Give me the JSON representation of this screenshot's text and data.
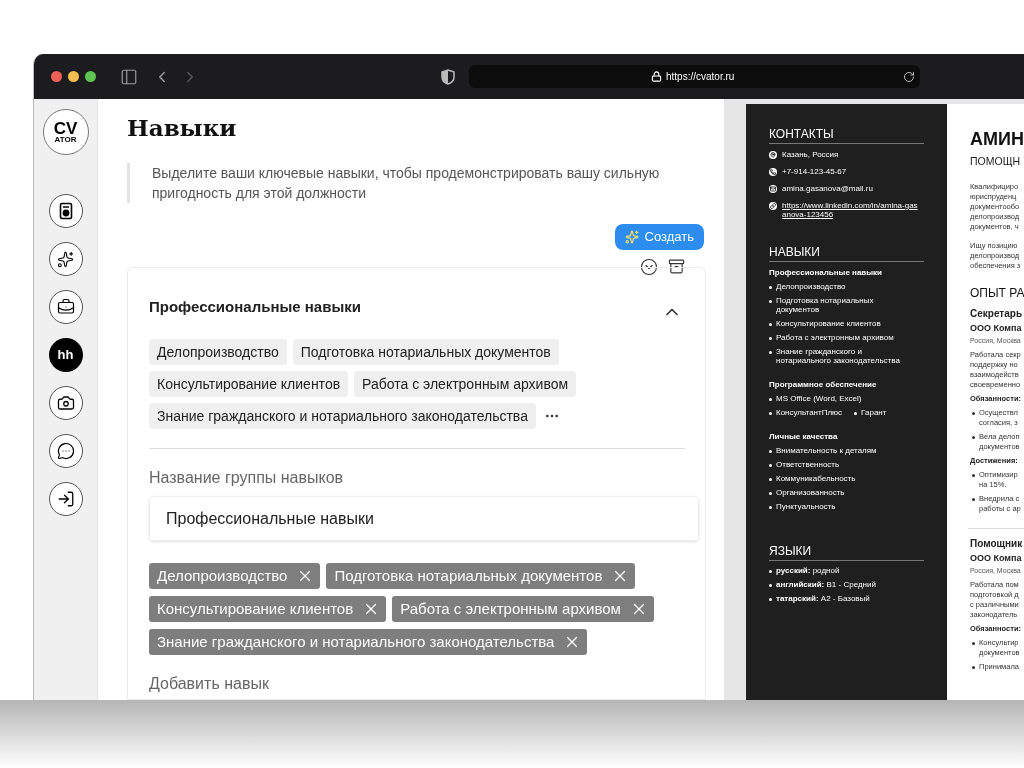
{
  "browser": {
    "url": "https://cvator.ru"
  },
  "sidebar": {
    "logo_top": "CV",
    "logo_bottom": "ATOR",
    "items": [
      {
        "selected": false
      },
      {
        "selected": false
      },
      {
        "selected": false
      },
      {
        "label": "hh",
        "selected": true
      },
      {
        "selected": false
      },
      {
        "selected": false
      },
      {
        "selected": false
      }
    ]
  },
  "editor": {
    "title": "Навыки",
    "hint": "Выделите ваши ключевые навыки, чтобы продемонстрировать вашу сильную пригодность для этой должности",
    "create_button": "Создать",
    "group": {
      "title": "Профессиональные навыки",
      "expanded": true,
      "preview_tags": [
        "Делопроизводство",
        "Подготовка нотариальных документов",
        "Консультирование клиентов",
        "Работа с электронным архивом",
        "Знание гражданского и нотариального законодательства"
      ],
      "name_label": "Название группы навыков",
      "name_value": "Профессиональные навыки",
      "tags": [
        "Делопроизводство",
        "Подготовка нотариальных документов",
        "Консультирование клиентов",
        "Работа с электронным архивом",
        "Знание гражданского и нотариального законодательства"
      ],
      "add_label": "Добавить навык"
    }
  },
  "resume": {
    "sidebar": {
      "contacts_title": "КОНТАКТЫ",
      "contacts": [
        {
          "kind": "location",
          "text": "Казань, Россия"
        },
        {
          "kind": "phone",
          "text": "+7-914-123-45-67"
        },
        {
          "kind": "email",
          "text": "amina.gasanova@mail.ru"
        },
        {
          "kind": "link",
          "text": "https://www.linkedin.com/in/amina-gasanova-123456"
        }
      ],
      "skills_title": "НАВЫКИ",
      "skill_groups": [
        {
          "title": "Профессиональные навыки",
          "items": [
            "Делопроизводство",
            "Подготовка нотариальных документов",
            "Консультирование клиентов",
            "Работа с электронным архивом",
            "Знание гражданского и нотариального законодательства"
          ]
        },
        {
          "title": "Программное обеспечение",
          "items": [
            "MS Office (Word, Excel)",
            "КонсультантПлюс",
            "Гарант"
          ]
        },
        {
          "title": "Личные качества",
          "items": [
            "Внимательность к деталям",
            "Ответственность",
            "Коммуникабельность",
            "Организованность",
            "Пунктуальность"
          ]
        }
      ],
      "languages_title": "ЯЗЫКИ",
      "languages": [
        "**русский:** родной",
        "**английский:** B1 - Средний",
        "**татарский:** A2 - Базовый"
      ]
    },
    "main": {
      "name": "АМИН",
      "role": "ПОМОЩН",
      "summary": [
        [
          "Квалифициро",
          "юриспруденц",
          "документообо",
          "делопроизвод",
          "документов, ч"
        ],
        [
          "Ищу позицию",
          "делопроизвод",
          "обеспечения з"
        ]
      ],
      "section_title": "ОПЫТ РА",
      "jobs": [
        {
          "title": "Секретарь",
          "company": "ООО Компа",
          "location": "Россия, Москва",
          "description": [
            "Работала секр",
            "поддержку но",
            "взаимодейств",
            "своевременно"
          ],
          "blocks": [
            {
              "heading": "Обязанности:",
              "bullets": [
                [
                  "Осуществл",
                  "согласия, з"
                ],
                [
                  "Вела делоп",
                  "документов"
                ]
              ]
            },
            {
              "heading": "Достижения:",
              "bullets": [
                [
                  "Оптимизир",
                  "на 15%."
                ],
                [
                  "Внедрила с",
                  "работы с ар"
                ]
              ]
            }
          ]
        },
        {
          "title": "Помощник",
          "company": "ООО Компа",
          "location": "Россия, Москва",
          "description": [
            "Работала пом",
            "подготовкой д",
            "с различными",
            "законодатель"
          ],
          "blocks": [
            {
              "heading": "Обязанности:",
              "bullets": [
                [
                  "Консультир",
                  "документов"
                ],
                [
                  "Принимала"
                ]
              ]
            }
          ]
        }
      ]
    }
  }
}
